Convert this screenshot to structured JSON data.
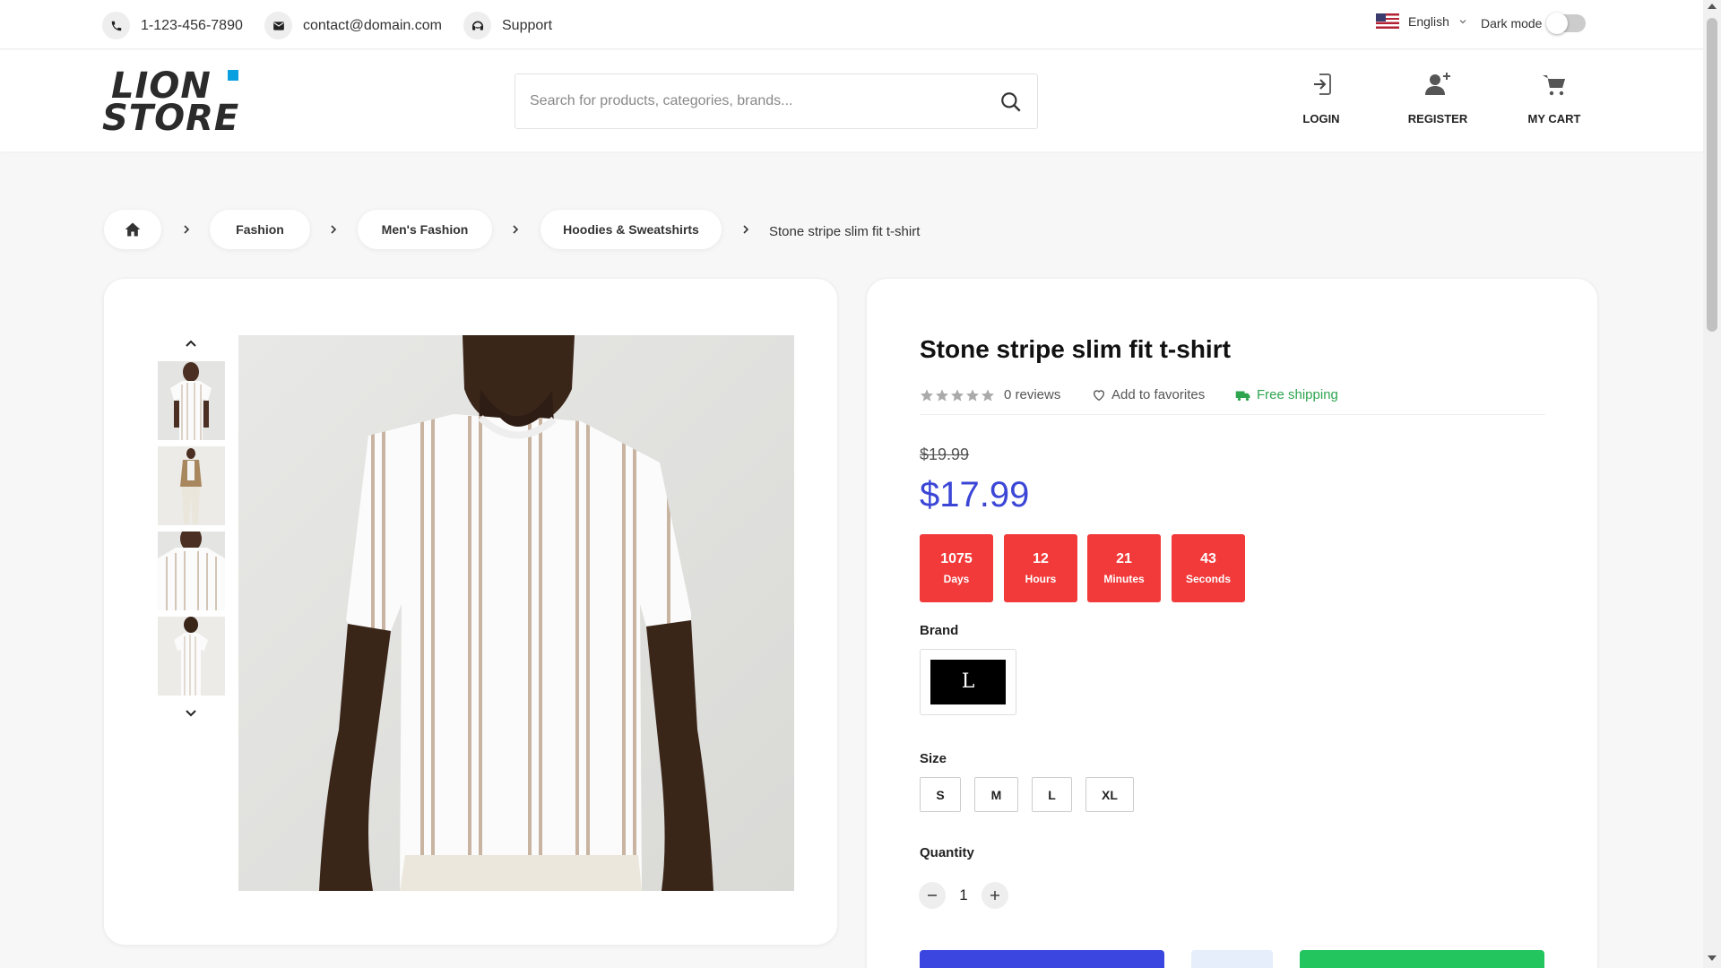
{
  "topbar": {
    "phone": "1-123-456-7890",
    "email": "contact@domain.com",
    "support": "Support",
    "language": "English",
    "dark_mode_label": "Dark mode",
    "dark_mode_on": false
  },
  "header": {
    "logo_line1": "LION",
    "logo_line2": "STORE",
    "search_placeholder": "Search for products, categories, brands...",
    "login": "LOGIN",
    "register": "REGISTER",
    "cart": "MY CART"
  },
  "breadcrumb": {
    "items": [
      "Fashion",
      "Men's Fashion",
      "Hoodies & Sweatshirts"
    ],
    "current": "Stone stripe slim fit t-shirt"
  },
  "product": {
    "title": "Stone stripe slim fit t-shirt",
    "rating": 0,
    "reviews": "0 reviews",
    "favorites": "Add to favorites",
    "shipping": "Free shipping",
    "old_price": "$19.99",
    "price": "$17.99",
    "countdown": [
      {
        "value": "1075",
        "unit": "Days"
      },
      {
        "value": "12",
        "unit": "Hours"
      },
      {
        "value": "21",
        "unit": "Minutes"
      },
      {
        "value": "43",
        "unit": "Seconds"
      }
    ],
    "brand_label": "Brand",
    "size_label": "Size",
    "sizes": [
      "S",
      "M",
      "L",
      "XL"
    ],
    "quantity_label": "Quantity",
    "quantity": "1"
  },
  "colors": {
    "accent_blue": "#3b46d6",
    "countdown_red": "#f23a3a",
    "shipping_green": "#2ea44f",
    "logo_square": "#0aa0e0"
  }
}
